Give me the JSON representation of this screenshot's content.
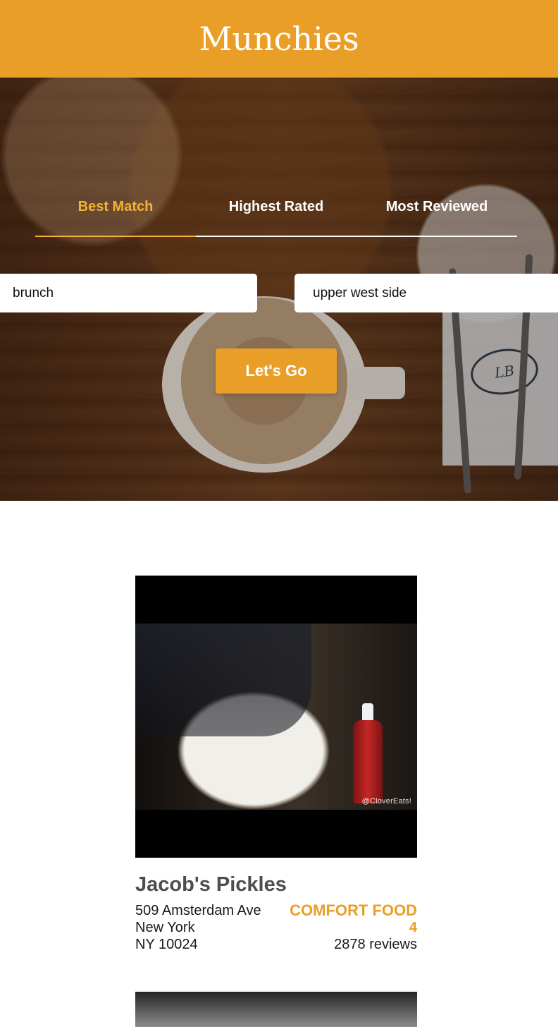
{
  "app": {
    "title": "Munchies",
    "accent_color": "#e99e27"
  },
  "tabs": [
    {
      "label": "Best Match",
      "active": true
    },
    {
      "label": "Highest Rated",
      "active": false
    },
    {
      "label": "Most Reviewed",
      "active": false
    }
  ],
  "search": {
    "term_value": "brunch",
    "location_value": "upper west side",
    "submit_label": "Let's Go"
  },
  "results": [
    {
      "name": "Jacob's Pickles",
      "address_line1": "509 Amsterdam Ave",
      "address_line2": "New York",
      "address_line3": "NY 10024",
      "category": "COMFORT FOOD",
      "rating": "4",
      "review_count": "2878 reviews",
      "image_credit": "@CloverEats!"
    }
  ]
}
